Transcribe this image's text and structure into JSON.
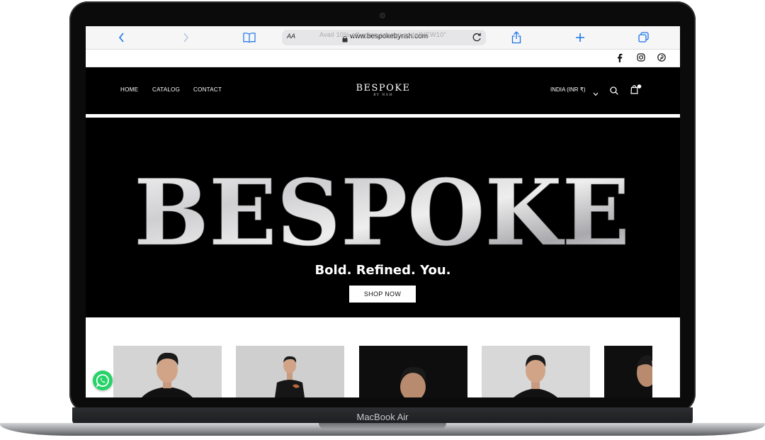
{
  "device": {
    "model_label": "MacBook Air"
  },
  "browser": {
    "url": "www.bespokebynsh.com",
    "aa_label": "AA",
    "back_icon": "chevron-left-icon",
    "forward_icon": "chevron-right-icon",
    "bookmarks_icon": "book-icon",
    "reload_icon": "reload-icon",
    "share_icon": "share-icon",
    "new_tab_icon": "plus-icon",
    "tabs_icon": "tabs-icon",
    "accent_color": "#1a73e8"
  },
  "announcement": {
    "text": "Avail 10% off using coupon code\"NEW10\"",
    "social": [
      "facebook-icon",
      "instagram-icon",
      "pinterest-icon"
    ]
  },
  "header": {
    "nav": [
      "HOME",
      "CATALOG",
      "CONTACT"
    ],
    "logo_main": "BESPOKE",
    "logo_sub": "BY NSH",
    "region": "INDIA (INR ₹)",
    "search_icon": "search-icon",
    "cart_icon": "bag-icon"
  },
  "hero": {
    "headline": "BESPOKE",
    "tagline": "Bold. Refined. You.",
    "cta": "SHOP NOW"
  },
  "products": {
    "count_visible": 5
  },
  "whatsapp": {
    "icon": "whatsapp-icon",
    "color": "#25d366"
  }
}
